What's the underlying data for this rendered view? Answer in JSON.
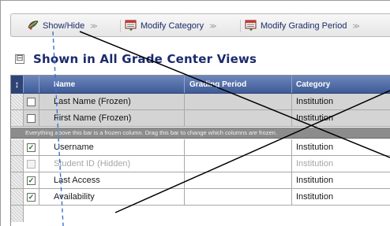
{
  "toolbar": {
    "items": [
      {
        "label": "Show/Hide",
        "icon": "eye-leaf-icon"
      },
      {
        "label": "Modify Category",
        "icon": "category-list-icon"
      },
      {
        "label": "Modify Grading Period",
        "icon": "grading-period-icon"
      }
    ]
  },
  "section": {
    "title": "Shown in All Grade Center Views",
    "collapse_symbol": "⊟"
  },
  "table": {
    "sort_symbol": "↕",
    "headers": {
      "name": "Name",
      "grading_period": "Grading Period",
      "category": "Category"
    },
    "frozen_rows": [
      {
        "name": "Last Name (Frozen)",
        "grading_period": "",
        "category": "Institution",
        "checked": false
      },
      {
        "name": "First Name (Frozen)",
        "grading_period": "",
        "category": "Institution",
        "checked": false
      }
    ],
    "frozen_bar_text": "Everything above this bar is a frozen column. Drag this bar to change which columns are frozen.",
    "rows": [
      {
        "name": "Username",
        "grading_period": "",
        "category": "Institution",
        "checked": true,
        "hidden": false
      },
      {
        "name": "Student ID  (Hidden)",
        "grading_period": "",
        "category": "Institution",
        "checked": false,
        "hidden": true
      },
      {
        "name": "Last Access",
        "grading_period": "",
        "category": "Institution",
        "checked": true,
        "hidden": false
      },
      {
        "name": "Availability",
        "grading_period": "",
        "category": "Institution",
        "checked": true,
        "hidden": false
      }
    ]
  },
  "colors": {
    "header_blue": "#4a64a0",
    "title_navy": "#1b2a6e",
    "frozen_gray": "#d4d4d4",
    "callout_line": "#000000",
    "drag_guide": "#3d6fd0"
  }
}
